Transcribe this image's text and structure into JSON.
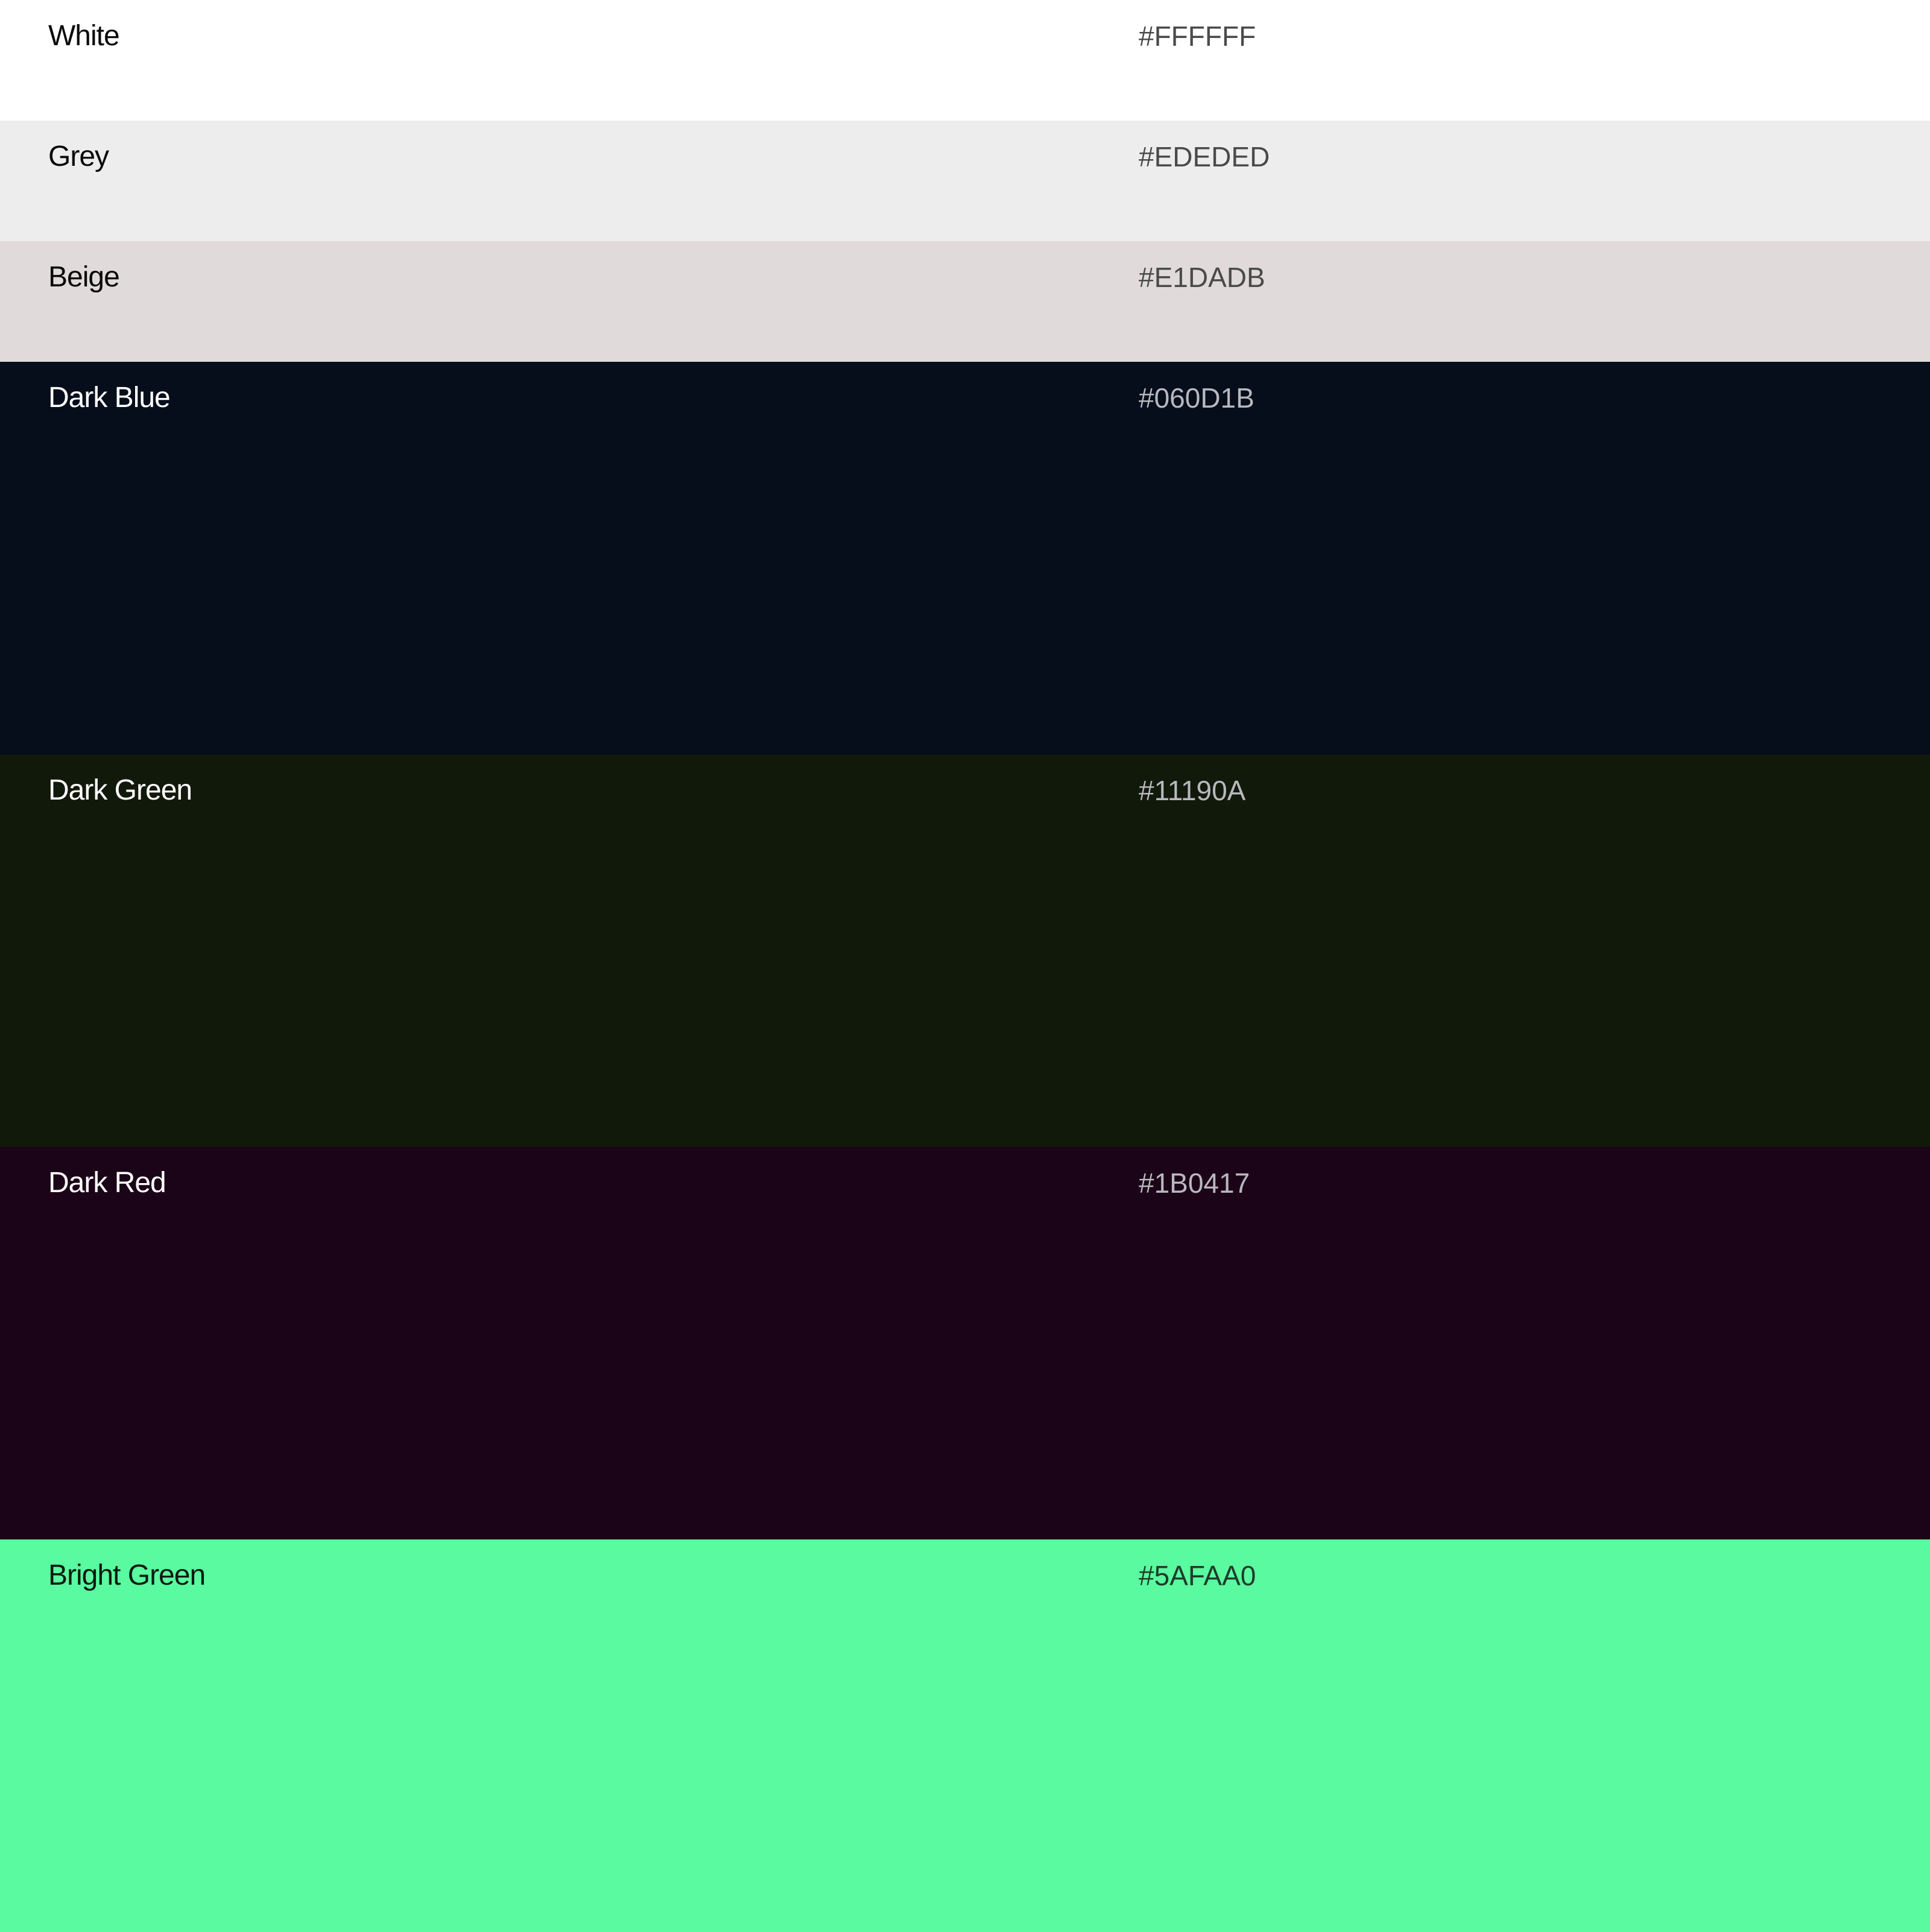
{
  "swatches": [
    {
      "name": "White",
      "hex": "#FFFFFF",
      "color": "#FFFFFF",
      "tone": "light",
      "size": "short"
    },
    {
      "name": "Grey",
      "hex": "#EDEDED",
      "color": "#EDEDED",
      "tone": "light",
      "size": "short"
    },
    {
      "name": "Beige",
      "hex": "#E1DADB",
      "color": "#E1DADB",
      "tone": "light",
      "size": "short"
    },
    {
      "name": "Dark Blue",
      "hex": "#060D1B",
      "color": "#060D1B",
      "tone": "dark",
      "size": "tall"
    },
    {
      "name": "Dark Green",
      "hex": "#11190A",
      "color": "#11190A",
      "tone": "dark",
      "size": "tall"
    },
    {
      "name": "Dark Red",
      "hex": "#1B0417",
      "color": "#1B0417",
      "tone": "dark",
      "size": "tall"
    },
    {
      "name": "Bright Green",
      "hex": "#5AFAA0",
      "color": "#5AFAA0",
      "tone": "accent",
      "size": "last"
    }
  ]
}
